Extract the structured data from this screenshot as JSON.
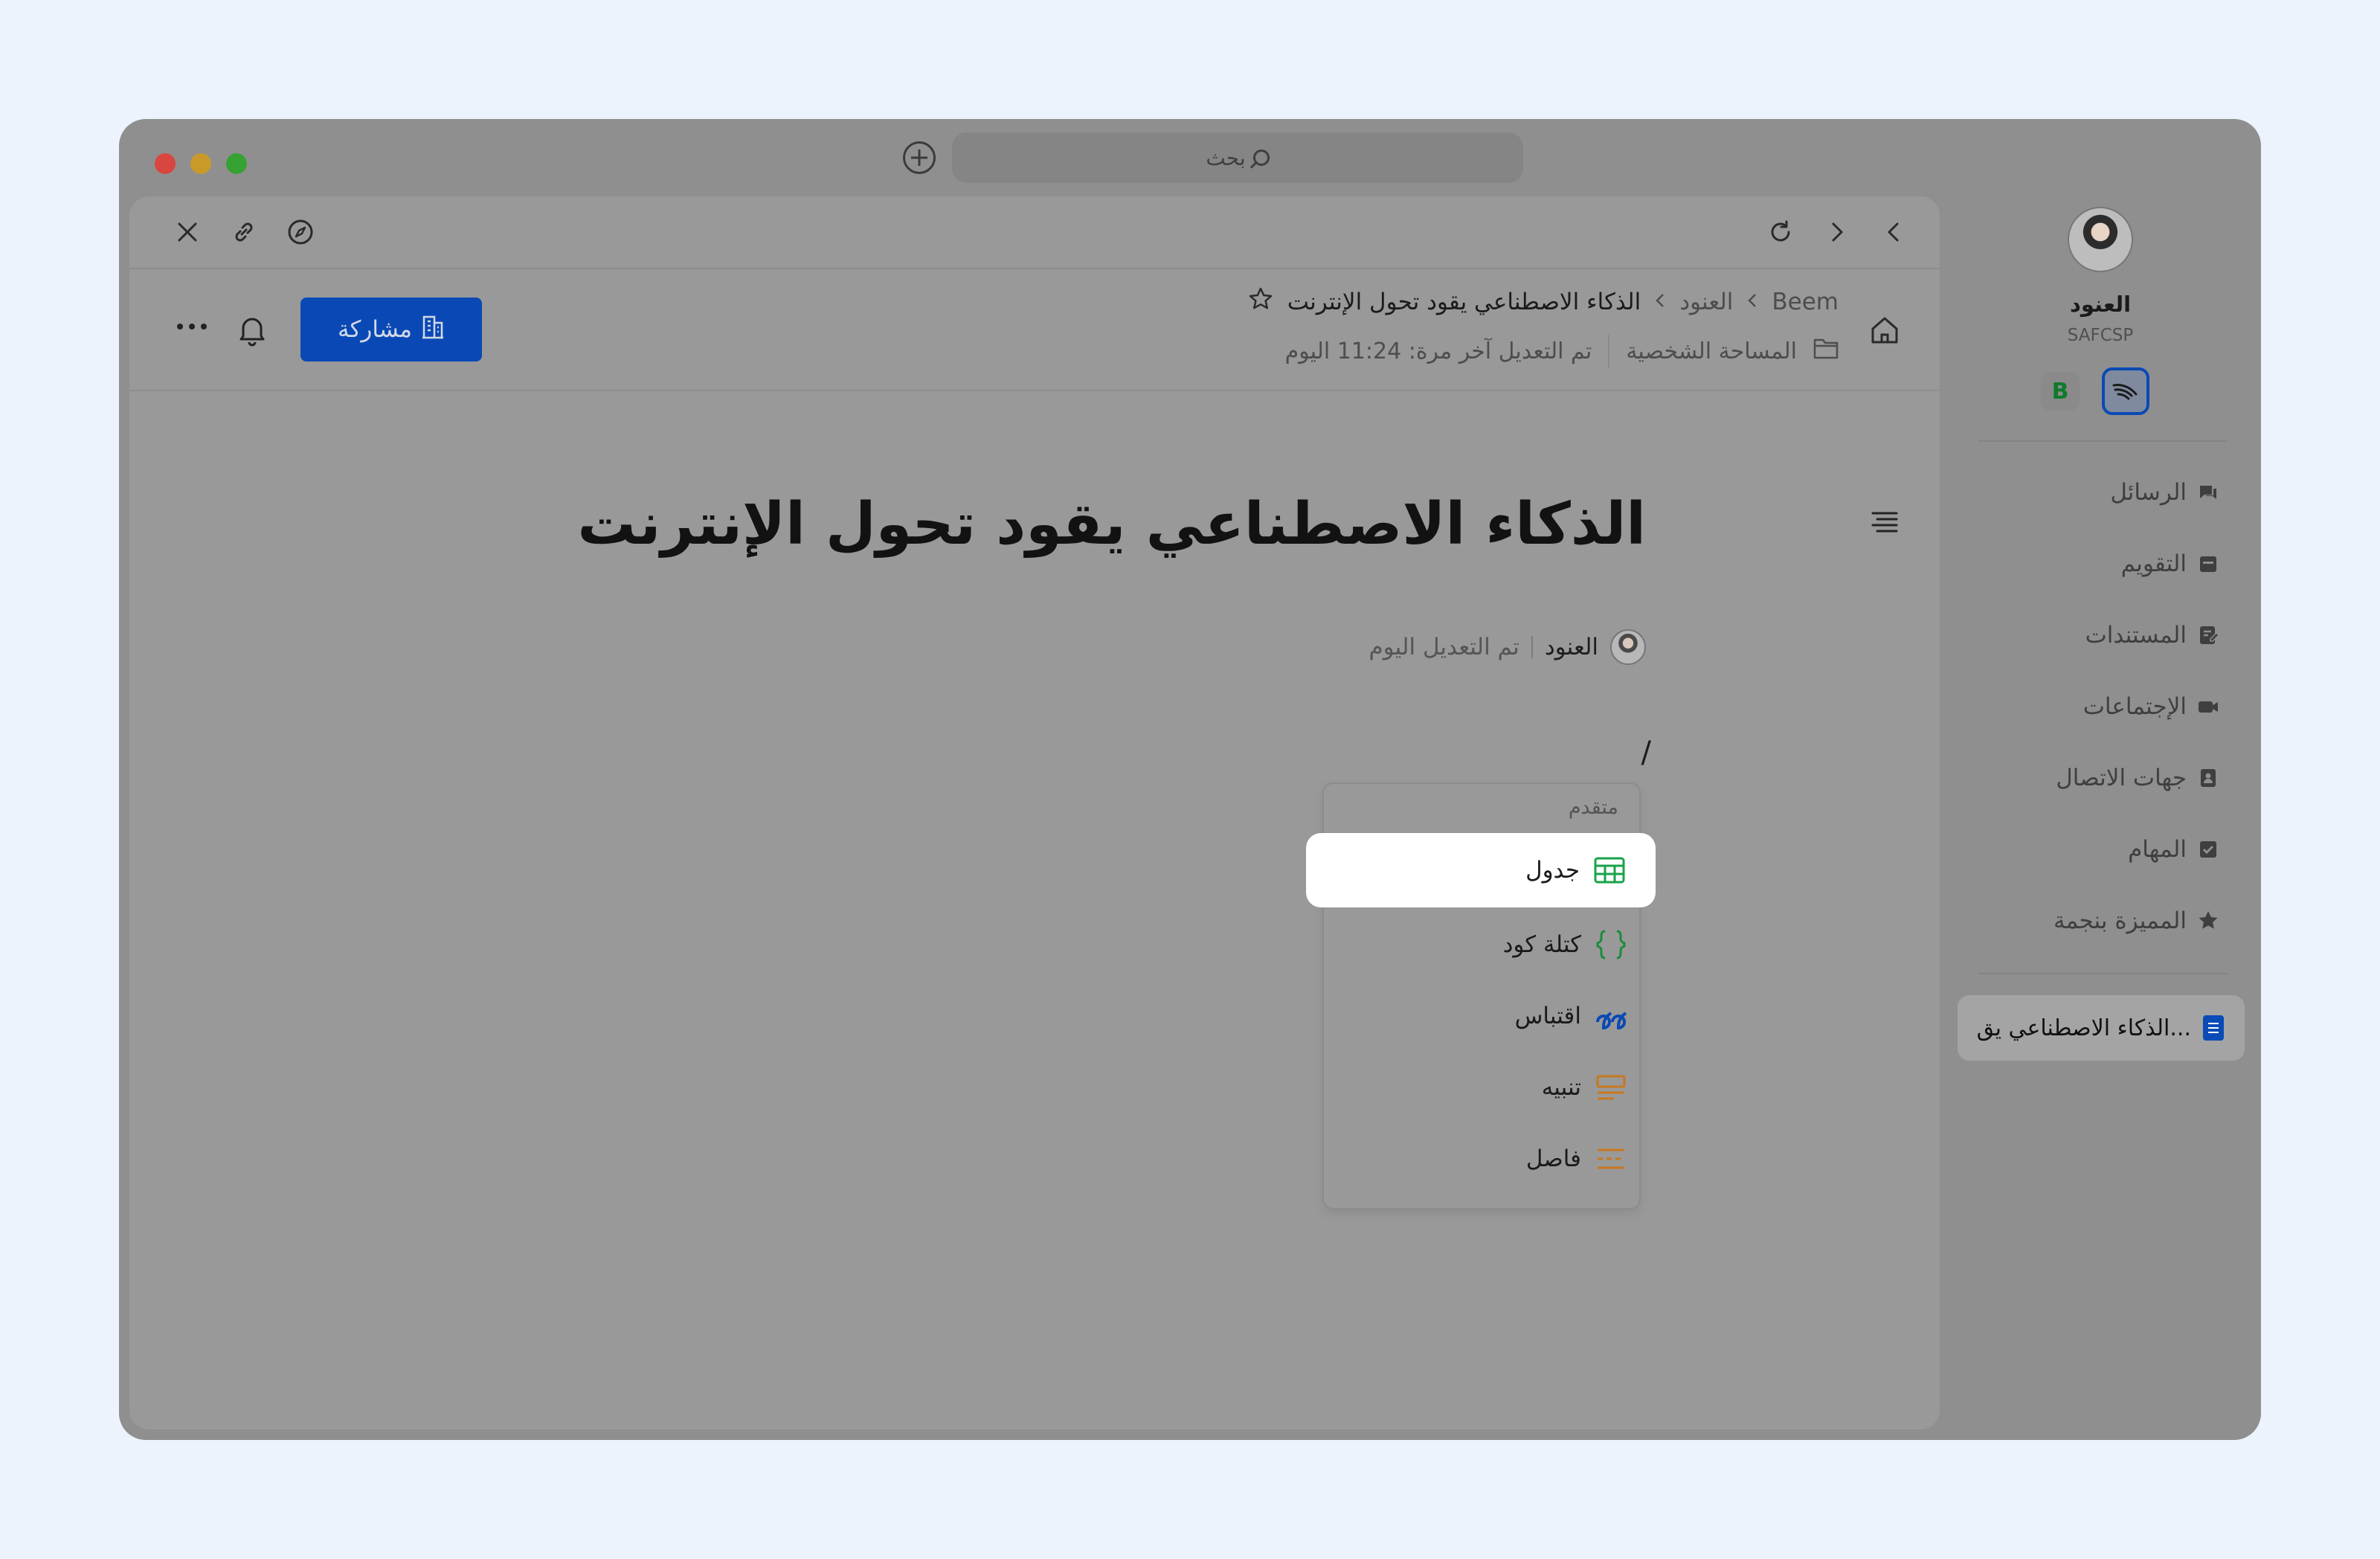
{
  "titlebar": {
    "search_placeholder": "بحث"
  },
  "sidebar": {
    "user": {
      "name": "العنود",
      "org": "SAFCSP"
    },
    "workspace_badge": "B",
    "items": [
      {
        "label": "الرسائل",
        "icon": "chat-icon"
      },
      {
        "label": "التقويم",
        "icon": "calendar-icon"
      },
      {
        "label": "المستندات",
        "icon": "documents-icon"
      },
      {
        "label": "الإجتماعات",
        "icon": "video-icon"
      },
      {
        "label": "جهات الاتصال",
        "icon": "contacts-icon"
      },
      {
        "label": "المهام",
        "icon": "tasks-icon"
      },
      {
        "label": "المميزة بنجمة",
        "icon": "star-icon"
      }
    ],
    "active_doc": "الذكاء الاصطناعي يق..."
  },
  "header": {
    "breadcrumb": [
      "Beem",
      "العنود",
      "الذكاء الاصطناعي يقود تحول الإنترنت"
    ],
    "location": "المساحة الشخصية",
    "last_edit": "تم التعديل آخر مرة: 11:24 اليوم",
    "share_label": "مشاركة"
  },
  "document": {
    "title": "الذكاء الاصطناعي يقود تحول الإنترنت",
    "author": "العنود",
    "edited": "تم التعديل اليوم",
    "slash": "/"
  },
  "slash_menu": {
    "section": "متقدم",
    "items": [
      {
        "label": "جدول",
        "icon": "table-icon",
        "highlighted": true
      },
      {
        "label": "كتلة كود",
        "icon": "code-block-icon"
      },
      {
        "label": "اقتباس",
        "icon": "quote-icon"
      },
      {
        "label": "تنبيه",
        "icon": "callout-icon"
      },
      {
        "label": "فاصل",
        "icon": "divider-icon"
      }
    ]
  },
  "colors": {
    "accent": "#0a49b5",
    "table_icon": "#1aa34a",
    "code_icon": "#1a8c3a",
    "quote_icon": "#0a49b5",
    "callout_icon": "#c7781e",
    "divider_icon": "#c7781e"
  }
}
